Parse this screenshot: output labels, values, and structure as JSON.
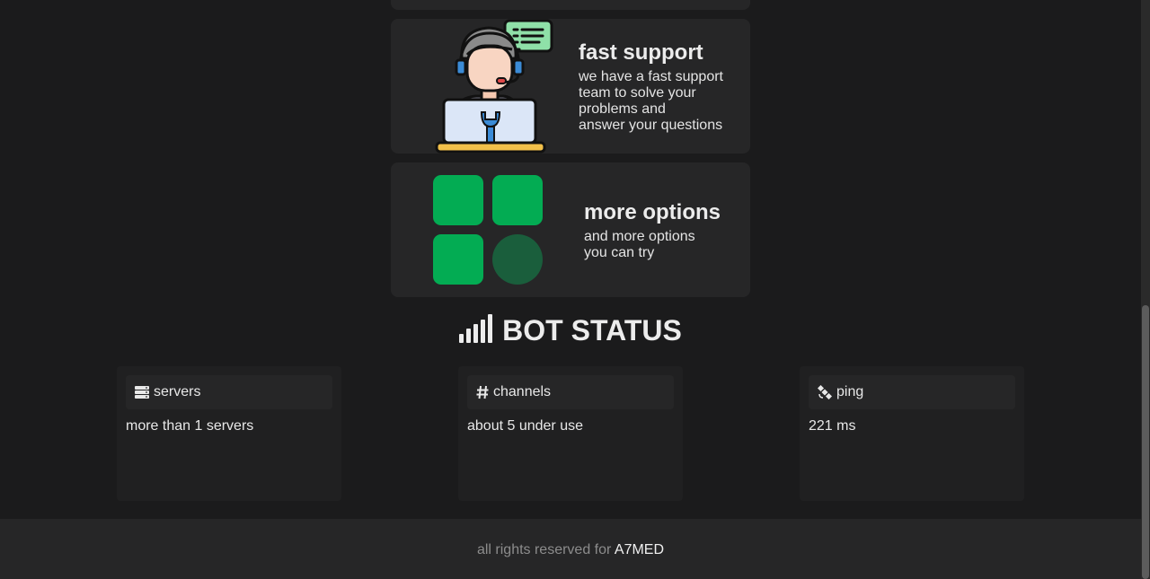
{
  "features": [
    {
      "title": "fast support",
      "description_lines": [
        "we have a fast support",
        "team to solve your",
        "problems and",
        "answer your questions"
      ],
      "icon": "support-agent-icon"
    },
    {
      "title": "more options",
      "description_lines": [
        "and more options",
        "you can try"
      ],
      "icon": "grid-options-icon"
    }
  ],
  "status": {
    "heading": "BOT STATUS",
    "heading_icon": "signal-bars-icon",
    "cards": [
      {
        "label": "servers",
        "icon": "server-icon",
        "value": "more than 1 servers"
      },
      {
        "label": "channels",
        "icon": "hashtag-icon",
        "value": "about 5 under use"
      },
      {
        "label": "ping",
        "icon": "satellite-icon",
        "value": "221 ms"
      }
    ]
  },
  "footer": {
    "text": "all rights reserved for",
    "owner": "A7MED"
  },
  "colors": {
    "background": "#1b1b1c",
    "card": "#262627",
    "accent_green": "#03ac53",
    "accent_green_dark": "#1a5e3c"
  }
}
